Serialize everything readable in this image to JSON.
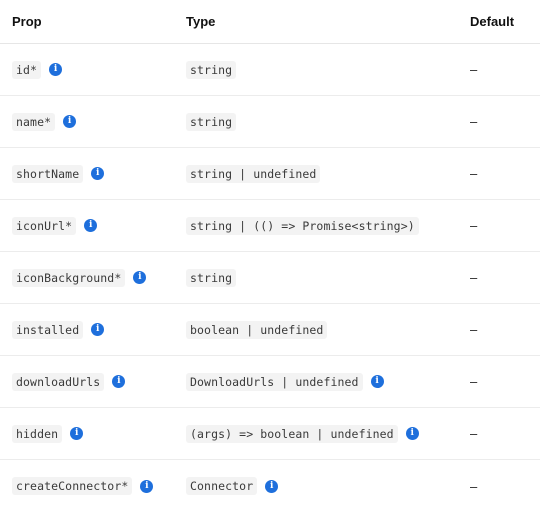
{
  "header": {
    "prop": "Prop",
    "type": "Type",
    "default": "Default"
  },
  "info_icon_glyph": "i",
  "rows": [
    {
      "prop": "id*",
      "type": "string",
      "type_info": false,
      "default": "–"
    },
    {
      "prop": "name*",
      "type": "string",
      "type_info": false,
      "default": "–"
    },
    {
      "prop": "shortName",
      "type": "string | undefined",
      "type_info": false,
      "default": "–"
    },
    {
      "prop": "iconUrl*",
      "type": "string | (() => Promise<string>)",
      "type_info": false,
      "default": "–"
    },
    {
      "prop": "iconBackground*",
      "type": "string",
      "type_info": false,
      "default": "–"
    },
    {
      "prop": "installed",
      "type": "boolean | undefined",
      "type_info": false,
      "default": "–"
    },
    {
      "prop": "downloadUrls",
      "type": "DownloadUrls | undefined",
      "type_info": true,
      "default": "–"
    },
    {
      "prop": "hidden",
      "type": "(args) => boolean | undefined",
      "type_info": true,
      "default": "–"
    },
    {
      "prop": "createConnector*",
      "type": "Connector",
      "type_info": true,
      "default": "–"
    }
  ],
  "colors": {
    "info_icon": "#1e6fdc",
    "code_bg": "#f3f3f3"
  }
}
